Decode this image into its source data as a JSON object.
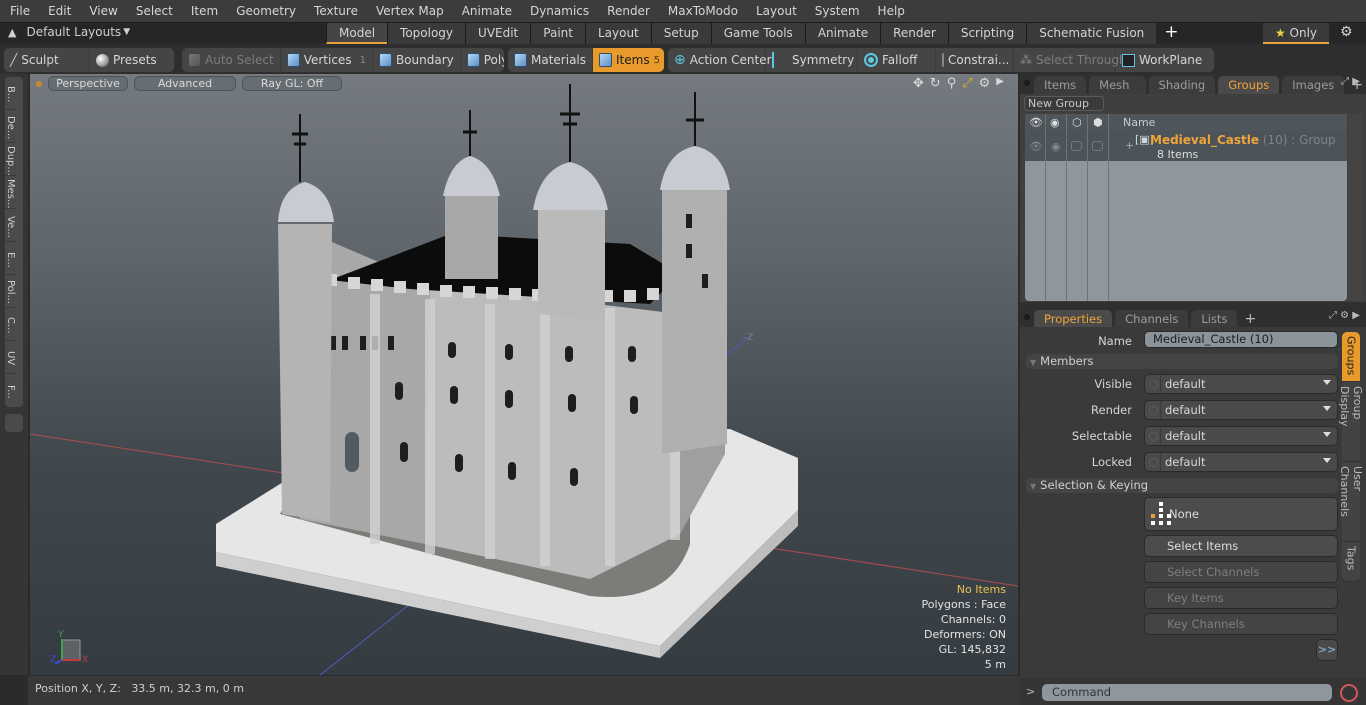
{
  "menubar": {
    "items": [
      "File",
      "Edit",
      "View",
      "Select",
      "Item",
      "Geometry",
      "Texture",
      "Vertex Map",
      "Animate",
      "Dynamics",
      "Render",
      "MaxToModo",
      "Layout",
      "System",
      "Help"
    ]
  },
  "layoutbar": {
    "layouts_label": "Default Layouts",
    "tabs": [
      "Model",
      "Topology",
      "UVEdit",
      "Paint",
      "Layout",
      "Setup",
      "Game Tools",
      "Animate",
      "Render",
      "Scripting",
      "Schematic Fusion"
    ],
    "active_tab": "Model",
    "add_tab": "+",
    "only_label": "Only",
    "accent": "#e8a03a"
  },
  "toolbar": {
    "sculpt": "Sculpt",
    "presets": "Presets",
    "auto_select": "Auto Select",
    "vertices": "Vertices",
    "vertices_count": "1",
    "boundary": "Boundary",
    "polygons": "Polygons",
    "materials": "Materials",
    "items": "Items",
    "items_count": "5",
    "action_center": "Action Center",
    "symmetry": "Symmetry",
    "falloff": "Falloff",
    "constraints": "Constrai...",
    "select_through": "Select Through",
    "workplane": "WorkPlane"
  },
  "leftstrip": {
    "tabs": [
      "B...",
      "De...",
      "Dup...",
      "Mes...",
      "Ve...",
      "E...",
      "Pol...",
      "C...",
      "UV",
      "F..."
    ]
  },
  "viewport": {
    "view_mode": "Perspective",
    "shading": "Advanced",
    "raygl": "Ray GL: Off",
    "axis_label_neg_z": "-Z",
    "info": {
      "selection": "No Items",
      "polygons": "Polygons : Face",
      "channels": "Channels: 0",
      "deformers": "Deformers: ON",
      "gl": "GL: 145,832",
      "scale": "5 m"
    },
    "gizmo": {
      "x": "X",
      "y": "Y",
      "z": "Z"
    }
  },
  "statusbar": {
    "position_label": "Position X, Y, Z:",
    "position_value": "33.5 m, 32.3 m, 0 m"
  },
  "groups_panel": {
    "tabs": [
      "Items",
      "Mesh ...",
      "Shading",
      "Groups",
      "Images"
    ],
    "active_tab": "Groups",
    "new_group": "New Group",
    "column_name": "Name",
    "group": {
      "name": "Medieval_Castle",
      "meta": " (10) : Group",
      "count": "8 Items"
    }
  },
  "properties_panel": {
    "tabs": [
      "Properties",
      "Channels",
      "Lists"
    ],
    "active_tab": "Properties",
    "name_label": "Name",
    "name_value": "Medieval_Castle (10)",
    "members_section": "Members",
    "fields": [
      {
        "label": "Visible",
        "value": "default"
      },
      {
        "label": "Render",
        "value": "default"
      },
      {
        "label": "Selectable",
        "value": "default"
      },
      {
        "label": "Locked",
        "value": "default"
      }
    ],
    "selection_section": "Selection & Keying",
    "none_button": "None",
    "select_items": "Select Items",
    "select_channels": "Select Channels",
    "key_items": "Key Items",
    "key_channels": "Key Channels",
    "more": ">>",
    "side_tabs": [
      "Groups",
      "Group Display",
      "User Channels",
      "Tags"
    ]
  },
  "command": {
    "prompt": ">",
    "placeholder": "Command"
  }
}
